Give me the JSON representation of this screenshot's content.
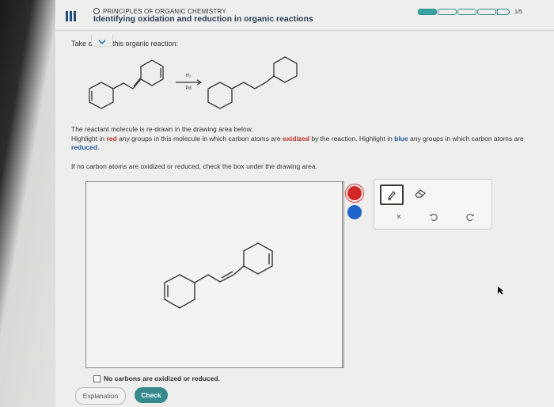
{
  "header": {
    "course": "PRINCIPLES OF ORGANIC CHEMISTRY",
    "topic": "Identifying oxidation and reduction in organic reactions",
    "progress_text": "1/5",
    "progress_filled": 1,
    "progress_total": 5
  },
  "question": {
    "prompt_start": "Take a l",
    "prompt_end": "t this organic reaction:",
    "reagent_top": "H₂",
    "reagent_bottom": "Pd",
    "line1": "The reactant molecule is re-drawn in the drawing area below.",
    "line2_a": "Highlight in ",
    "line2_red": "red",
    "line2_b": " any groups in this molecule in which carbon atoms are ",
    "line2_oxidized": "oxidized",
    "line2_c": " by the reaction. Highlight in ",
    "line2_blue": "blue",
    "line2_d": " any groups in which carbon atoms are ",
    "line2_reduced": "reduced",
    "line2_e": ".",
    "line3": "If no carbon atoms are oxidized or reduced, check the box under the drawing area."
  },
  "tools": {
    "colors": [
      "#d32626",
      "#1e63c8"
    ],
    "icons": [
      "highlighter-icon",
      "eraser-icon",
      "clear-icon",
      "undo-icon",
      "redo-icon"
    ],
    "clear_label": "×"
  },
  "checkbox_label": "No carbons are oxidized or reduced.",
  "buttons": {
    "explanation": "Explanation",
    "check": "Check"
  }
}
